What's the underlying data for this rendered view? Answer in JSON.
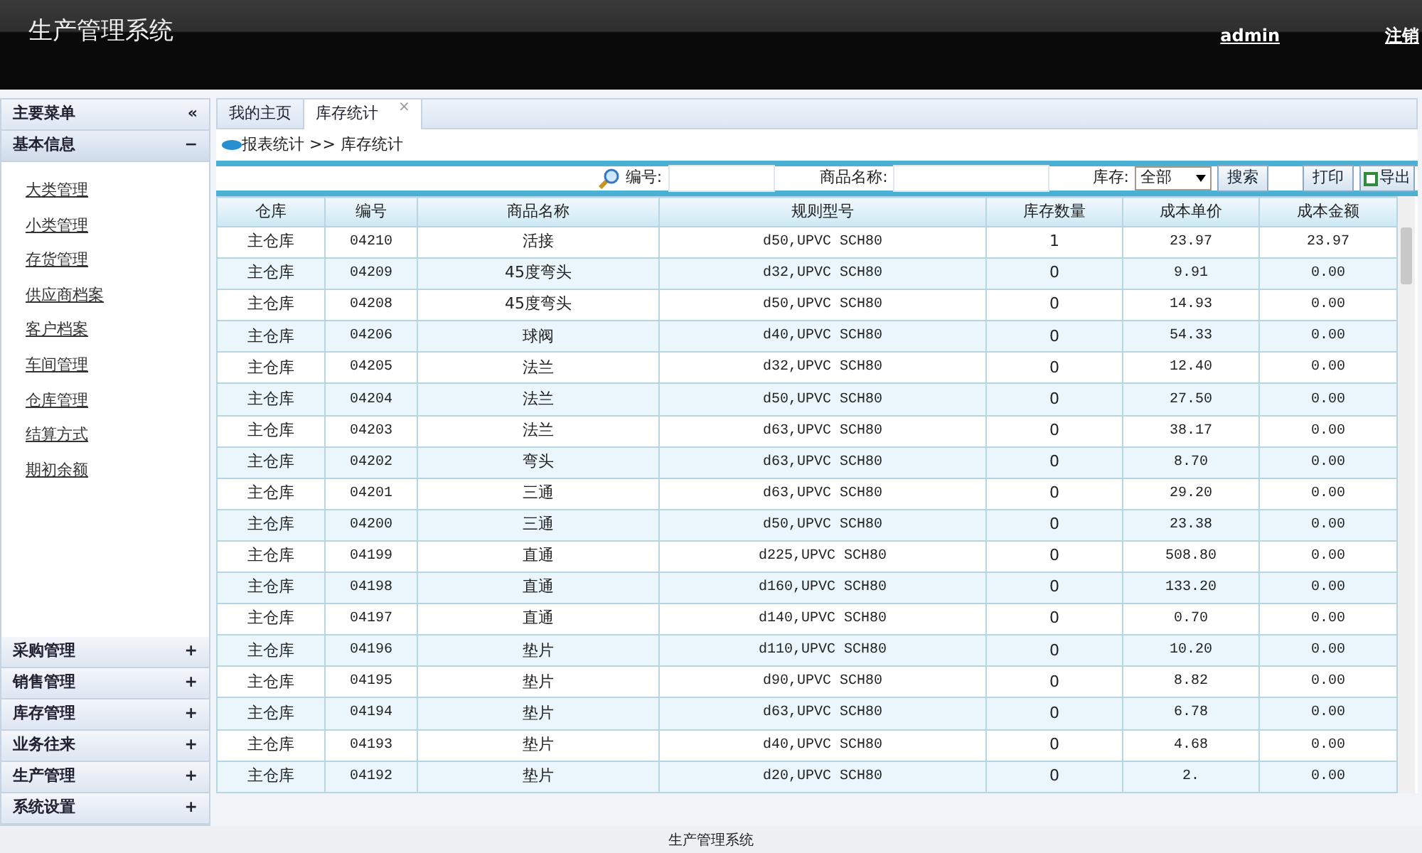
{
  "header": {
    "title": "生产管理系统",
    "user": "admin",
    "logout": "注销"
  },
  "sidebar": {
    "title": "主要菜单",
    "collapse": "«",
    "sections": [
      {
        "label": "基本信息",
        "expanded": true,
        "toggle": "−",
        "items": [
          "大类管理",
          "小类管理",
          "存货管理",
          "供应商档案",
          "客户档案",
          "车间管理",
          "仓库管理",
          "结算方式",
          "期初余额"
        ]
      },
      {
        "label": "采购管理",
        "expanded": false,
        "toggle": "+"
      },
      {
        "label": "销售管理",
        "expanded": false,
        "toggle": "+"
      },
      {
        "label": "库存管理",
        "expanded": false,
        "toggle": "+"
      },
      {
        "label": "业务往来",
        "expanded": false,
        "toggle": "+"
      },
      {
        "label": "生产管理",
        "expanded": false,
        "toggle": "+"
      },
      {
        "label": "系统设置",
        "expanded": false,
        "toggle": "+"
      }
    ]
  },
  "tabs": [
    {
      "label": "我的主页",
      "selected": false
    },
    {
      "label": "库存统计",
      "selected": true,
      "close": "×"
    }
  ],
  "breadcrumb": "报表统计 >> 库存统计",
  "search": {
    "code_label": "编号:",
    "name_label": "商品名称:",
    "stock_label": "库存:",
    "stock_value": "全部",
    "search_button": "搜索",
    "print_button": "打印",
    "export_button": "导出"
  },
  "table": {
    "columns": [
      "仓库",
      "编号",
      "商品名称",
      "规则型号",
      "库存数量",
      "成本单价",
      "成本金额"
    ],
    "rows": [
      [
        "主仓库",
        "04210",
        "活接",
        "d50,UPVC SCH80",
        "1",
        "23.97",
        "23.97"
      ],
      [
        "主仓库",
        "04209",
        "45度弯头",
        "d32,UPVC SCH80",
        "0",
        "9.91",
        "0.00"
      ],
      [
        "主仓库",
        "04208",
        "45度弯头",
        "d50,UPVC SCH80",
        "0",
        "14.93",
        "0.00"
      ],
      [
        "主仓库",
        "04206",
        "球阀",
        "d40,UPVC SCH80",
        "0",
        "54.33",
        "0.00"
      ],
      [
        "主仓库",
        "04205",
        "法兰",
        "d32,UPVC SCH80",
        "0",
        "12.40",
        "0.00"
      ],
      [
        "主仓库",
        "04204",
        "法兰",
        "d50,UPVC SCH80",
        "0",
        "27.50",
        "0.00"
      ],
      [
        "主仓库",
        "04203",
        "法兰",
        "d63,UPVC SCH80",
        "0",
        "38.17",
        "0.00"
      ],
      [
        "主仓库",
        "04202",
        "弯头",
        "d63,UPVC SCH80",
        "0",
        "8.70",
        "0.00"
      ],
      [
        "主仓库",
        "04201",
        "三通",
        "d63,UPVC SCH80",
        "0",
        "29.20",
        "0.00"
      ],
      [
        "主仓库",
        "04200",
        "三通",
        "d50,UPVC SCH80",
        "0",
        "23.38",
        "0.00"
      ],
      [
        "主仓库",
        "04199",
        "直通",
        "d225,UPVC SCH80",
        "0",
        "508.80",
        "0.00"
      ],
      [
        "主仓库",
        "04198",
        "直通",
        "d160,UPVC SCH80",
        "0",
        "133.20",
        "0.00"
      ],
      [
        "主仓库",
        "04197",
        "直通",
        "d140,UPVC SCH80",
        "0",
        "0.70",
        "0.00"
      ],
      [
        "主仓库",
        "04196",
        "垫片",
        "d110,UPVC SCH80",
        "0",
        "10.20",
        "0.00"
      ],
      [
        "主仓库",
        "04195",
        "垫片",
        "d90,UPVC SCH80",
        "0",
        "8.82",
        "0.00"
      ],
      [
        "主仓库",
        "04194",
        "垫片",
        "d63,UPVC SCH80",
        "0",
        "6.78",
        "0.00"
      ],
      [
        "主仓库",
        "04193",
        "垫片",
        "d40,UPVC SCH80",
        "0",
        "4.68",
        "0.00"
      ],
      [
        "主仓库",
        "04192",
        "垫片",
        "d20,UPVC SCH80",
        "0",
        "2.",
        "0.00"
      ]
    ]
  },
  "footer": "生产管理系统"
}
